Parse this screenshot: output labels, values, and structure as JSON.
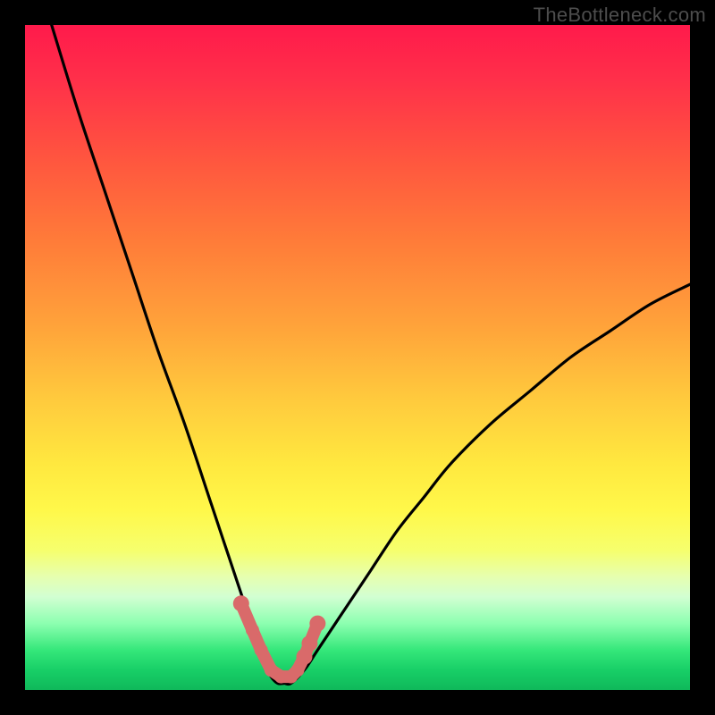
{
  "watermark": "TheBottleneck.com",
  "chart_data": {
    "type": "line",
    "title": "",
    "xlabel": "",
    "ylabel": "",
    "xlim": [
      0,
      100
    ],
    "ylim": [
      0,
      100
    ],
    "grid": false,
    "series": [
      {
        "name": "bottleneck-curve",
        "color": "#000000",
        "x": [
          4,
          8,
          12,
          16,
          20,
          24,
          28,
          30,
          32,
          34,
          35,
          36,
          37,
          38,
          39,
          40,
          42,
          44,
          48,
          52,
          56,
          60,
          64,
          70,
          76,
          82,
          88,
          94,
          100
        ],
        "y": [
          100,
          87,
          75,
          63,
          51,
          40,
          28,
          22,
          16,
          10,
          7,
          4,
          2,
          1,
          1,
          1,
          3,
          6,
          12,
          18,
          24,
          29,
          34,
          40,
          45,
          50,
          54,
          58,
          61
        ]
      },
      {
        "name": "highlight-beads",
        "color": "#d96a6a",
        "type": "scatter",
        "x": [
          32.5,
          34.2,
          35.5,
          37.0,
          38.5,
          40.0,
          41.0,
          42.0,
          42.8,
          44.0
        ],
        "y": [
          13,
          9,
          6,
          3,
          2,
          2,
          3,
          5,
          7,
          10
        ]
      }
    ],
    "annotations": []
  },
  "colors": {
    "frame": "#000000",
    "curve": "#000000",
    "beads": "#d96a6a"
  }
}
